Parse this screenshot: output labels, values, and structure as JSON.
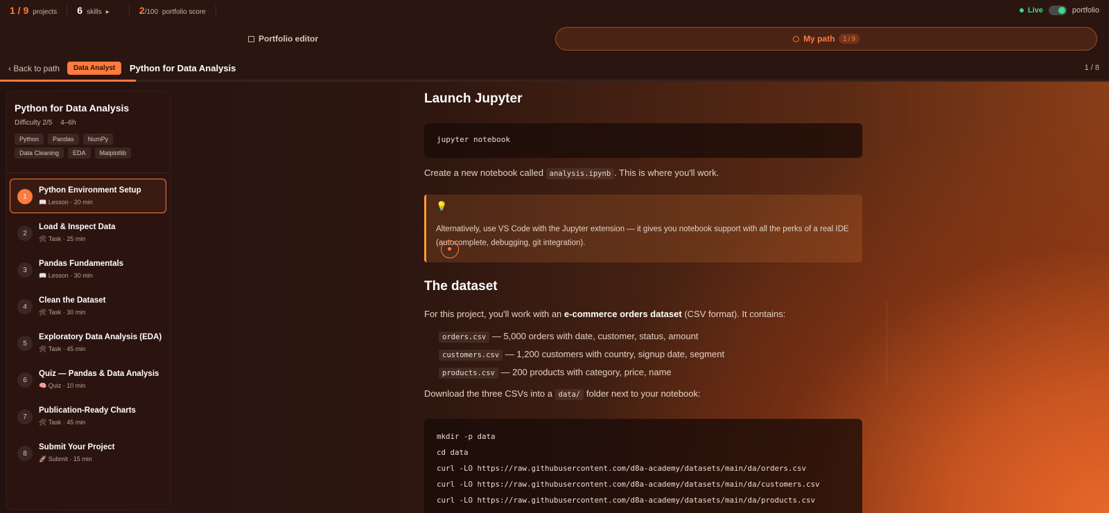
{
  "topbar": {
    "projects_value": "1 / 9",
    "projects_label": "projects",
    "skills_value": "6",
    "skills_label": "skills",
    "skills_arrow": "▸",
    "score_value": "2",
    "score_max": "/100",
    "score_label": "portfolio score",
    "live_label": "Live",
    "portfolio_label": "portfolio"
  },
  "nav": {
    "editor_label": "Portfolio editor",
    "mypath_label": "My path",
    "mypath_count": "1 / 9"
  },
  "breadcrumb": {
    "back_label": "‹ Back to path",
    "badge": "Data Analyst",
    "title": "Python for Data Analysis",
    "count": "1 / 8"
  },
  "sidebar": {
    "title": "Python for Data Analysis",
    "difficulty": "Difficulty 2/5",
    "duration": "4–6h",
    "tags": [
      "Python",
      "Pandas",
      "NumPy",
      "Data Cleaning",
      "EDA",
      "Matplotlib"
    ],
    "steps": [
      {
        "num": "1",
        "title": "Python Environment Setup",
        "meta": "📖 Lesson · 20 min"
      },
      {
        "num": "2",
        "title": "Load & Inspect Data",
        "meta": "🛠 Task · 25 min"
      },
      {
        "num": "3",
        "title": "Pandas Fundamentals",
        "meta": "📖 Lesson · 30 min"
      },
      {
        "num": "4",
        "title": "Clean the Dataset",
        "meta": "🛠 Task · 30 min"
      },
      {
        "num": "5",
        "title": "Exploratory Data Analysis (EDA)",
        "meta": "🛠 Task · 45 min"
      },
      {
        "num": "6",
        "title": "Quiz — Pandas & Data Analysis",
        "meta": "🧠 Quiz · 10 min"
      },
      {
        "num": "7",
        "title": "Publication-Ready Charts",
        "meta": "🛠 Task · 45 min"
      },
      {
        "num": "8",
        "title": "Submit Your Project",
        "meta": "🚀 Submit · 15 min"
      }
    ]
  },
  "content": {
    "h_launch": "Launch Jupyter",
    "code1": "jupyter notebook",
    "p1_a": "Create a new notebook called",
    "p1_code": "analysis.ipynb",
    "p1_b": ". This is where you'll work.",
    "callout_icon": "💡",
    "callout_text": "Alternatively, use VS Code with the Jupyter extension — it gives you notebook support with all the perks of a real IDE (autocomplete, debugging, git integration).",
    "h_dataset": "The dataset",
    "p2_a": "For this project, you'll work with an",
    "p2_bold": "e-commerce orders dataset",
    "p2_b": "(CSV format). It contains:",
    "files": [
      {
        "name": "orders.csv",
        "desc": "— 5,000 orders with date, customer, status, amount"
      },
      {
        "name": "customers.csv",
        "desc": "— 1,200 customers with country, signup date, segment"
      },
      {
        "name": "products.csv",
        "desc": "— 200 products with category, price, name"
      }
    ],
    "p3_a": "Download the three CSVs into a",
    "p3_code": "data/",
    "p3_b": "folder next to your notebook:",
    "code2": [
      "mkdir -p data",
      "cd data",
      "curl -LO https://raw.githubusercontent.com/d8a-academy/datasets/main/da/orders.csv",
      "curl -LO https://raw.githubusercontent.com/d8a-academy/datasets/main/da/customers.csv",
      "curl -LO https://raw.githubusercontent.com/d8a-academy/datasets/main/da/products.csv"
    ]
  },
  "colors": {
    "accent": "#ff7a3d",
    "live": "#3ddc84",
    "panel": "#2b1410"
  }
}
